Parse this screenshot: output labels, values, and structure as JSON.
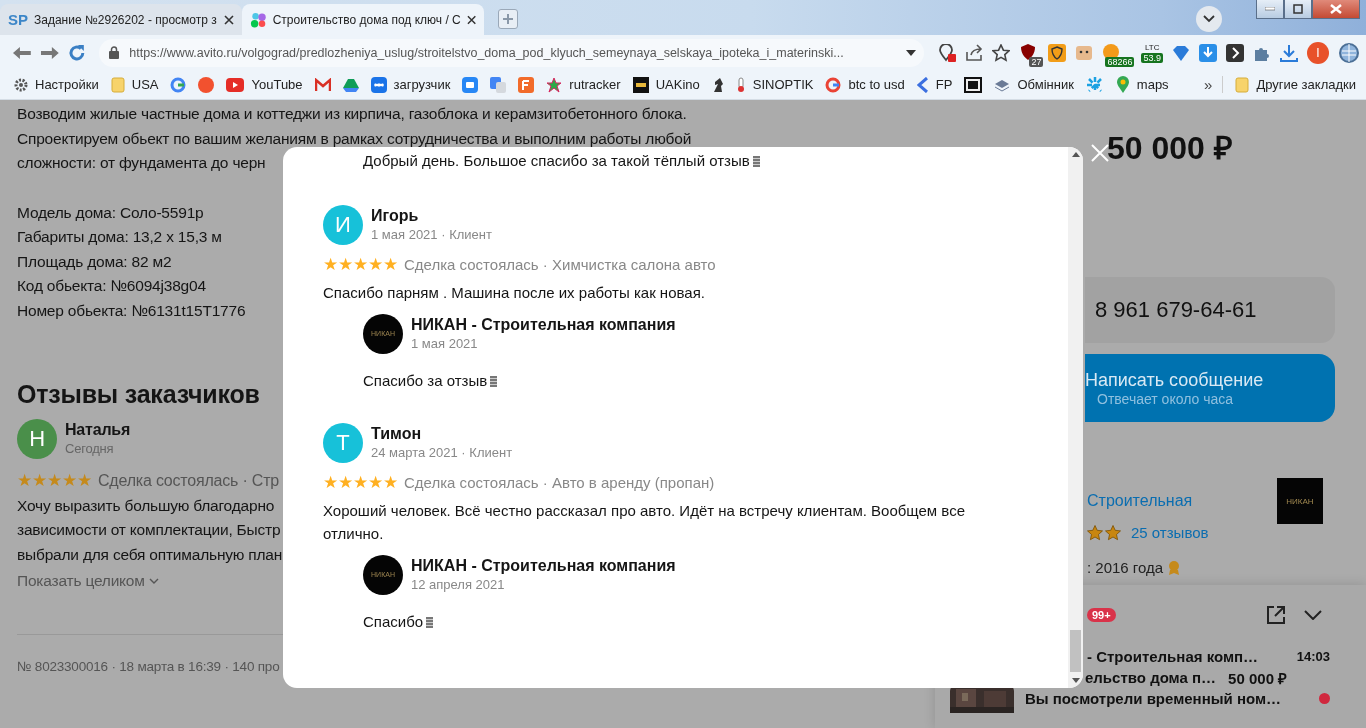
{
  "browser": {
    "tabs": [
      {
        "favicon_text": "SP",
        "title": "Задание №2926202 - просмотр з",
        "selected": false
      },
      {
        "title": "Строительство дома под ключ / С",
        "selected": true
      }
    ],
    "address": "https://www.avito.ru/volgograd/predlozheniya_uslug/stroitelstvo_doma_pod_klyuch_semeynaya_selskaya_ipoteka_i_materinski...",
    "extensions": [
      {
        "badge": "27"
      },
      {
        "badge": "68266"
      },
      {
        "label": "LTC",
        "badge": "53.9"
      }
    ],
    "profile": "I",
    "bookmarks": [
      {
        "kind": "labeled",
        "label": "Настройки"
      },
      {
        "kind": "labeled",
        "label": "USA"
      },
      {
        "kind": "icon"
      },
      {
        "kind": "icon"
      },
      {
        "kind": "labeled",
        "label": "YouTube"
      },
      {
        "kind": "icon"
      },
      {
        "kind": "icon"
      },
      {
        "kind": "labeled",
        "label": "загрузчик"
      },
      {
        "kind": "icon"
      },
      {
        "kind": "icon"
      },
      {
        "kind": "icon"
      },
      {
        "kind": "labeled",
        "label": "rutracker"
      },
      {
        "kind": "labeled",
        "label": "UAKino"
      },
      {
        "kind": "icon"
      },
      {
        "kind": "labeled",
        "label": "SINOPTIK"
      },
      {
        "kind": "labeled",
        "label": "btc to usd"
      },
      {
        "kind": "labeled",
        "label": "FP"
      },
      {
        "kind": "icon"
      },
      {
        "kind": "labeled",
        "label": "Обмінник"
      },
      {
        "kind": "icon"
      },
      {
        "kind": "labeled",
        "label": "maps"
      }
    ],
    "more": "»",
    "other_bookmarks": "Другие закладки"
  },
  "listing": {
    "description": [
      "Возводим жилые частные дома и коттеджи из кирпича, газоблока и керамзитобетонного блока.",
      "Спроектируем обьект по вашим желаниям в рамках сотрудничества и выполним работы любой",
      "сложности: от фундамента до черн"
    ],
    "specs": [
      "Модель дома: Соло-5591р",
      "Габариты дома: 13,2 х 15,3 м",
      "Площадь дома: 82 м2",
      "Код обьекта: №6094j38g04",
      "Номер обьекта: №6131t15T1776"
    ],
    "reviews_heading": "Отзывы заказчиков",
    "review": {
      "initial": "Н",
      "color": "#4a8f4a",
      "name": "Наталья",
      "date": "Сегодня",
      "stars": 5,
      "deal": "Сделка состоялась · Стр",
      "text": [
        "Хочу выразить большую благодарно",
        "зависимости от комплектации, Быстр",
        "выбрали для себя оптимальную план"
      ]
    },
    "show_more": "Показать целиком",
    "footer": "№ 8023300016 · 18 марта в 16:39 · 140 про"
  },
  "sidebar": {
    "price": "50 000 ₽",
    "phone": "8 961 679-64-61",
    "message_button": "Написать сообщение",
    "message_hint": "Отвечает около часа",
    "seller": {
      "name": "Строительная",
      "logo_text": "НИКАН",
      "reviews_link": "25 отзывов",
      "since": ": 2016 года"
    }
  },
  "modal": {
    "top_reply": "Добрый день. Большое спасибо за такой тёплый отзыв",
    "reviews": [
      {
        "initial": "И",
        "color": "#17c1d9",
        "name": "Игорь",
        "meta": "1 мая 2021 · Клиент",
        "stars": 5,
        "deal": "Сделка состоялась · Химчистка салона авто",
        "text": "Спасибо парням . Машина после их работы как новая.",
        "reply": {
          "logo_text": "НИКАН",
          "name": "НИКАН - Строительная компания",
          "date": "1 мая 2021",
          "text": "Спасибо за отзыв"
        }
      },
      {
        "initial": "Т",
        "color": "#17c1d9",
        "name": "Тимон",
        "meta": "24 марта 2021 · Клиент",
        "stars": 5,
        "deal": "Сделка состоялась · Авто в аренду (пропан)",
        "text": "Хороший человек. Всё честно рассказал про авто. Идёт на встречу клиентам. Вообщем все отлично.",
        "reply": {
          "logo_text": "НИКАН",
          "name": "НИКАН - Строительная компания",
          "date": "12 апреля 2021",
          "text": "Спасибо"
        }
      }
    ]
  },
  "widget": {
    "badge": "99+",
    "chat": {
      "title": "- Строительная комп…",
      "subtitle": "ельство дома п…",
      "price": "50 000 ₽",
      "time": "14:03",
      "preview": "Вы посмотрели временный ном…",
      "unread": true
    }
  }
}
